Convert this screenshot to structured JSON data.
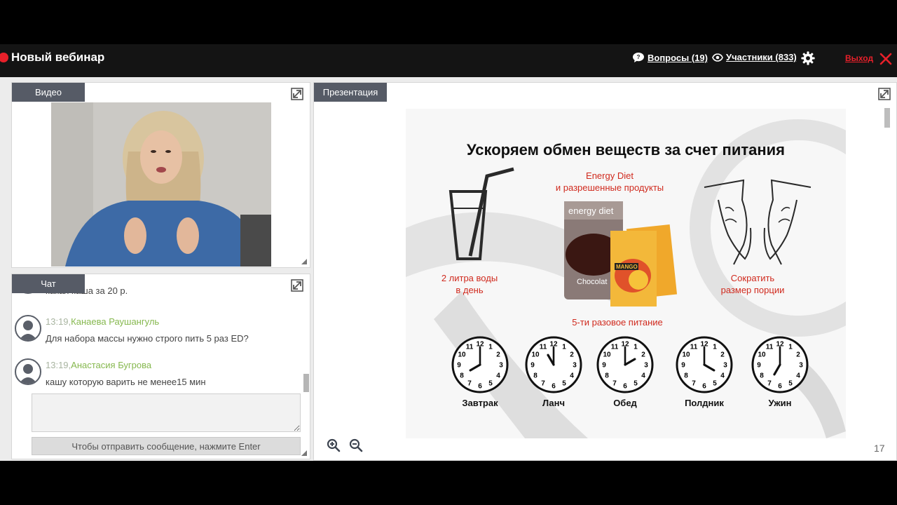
{
  "header": {
    "title": "Новый вебинар",
    "questions_label": "Вопросы (19)",
    "participants_label": "Участники (833)",
    "exit_label": "Выход",
    "accent_color": "#e8202a"
  },
  "video_panel": {
    "tab_label": "Видео"
  },
  "chat_panel": {
    "tab_label": "Чат",
    "partial_message_text": "какая каша за 20 р.",
    "messages": [
      {
        "time": "13:19,",
        "author": "Канаева Раушангуль",
        "text": "Для набора массы нужно строго пить 5 раз ED?"
      },
      {
        "time": "13:19,",
        "author": "Анастасия Бугрова",
        "text": "кашу которую варить не менее15 мин"
      }
    ],
    "send_hint": "Чтобы отправить сообщение, нажмите Enter"
  },
  "presentation_panel": {
    "tab_label": "Презентация",
    "page_number": "17",
    "slide": {
      "title": "Ускоряем обмен веществ за счет питания",
      "water_caption": "2 литра воды\nв день",
      "product_caption": "Energy Diet\nи разрешенные продукты",
      "portion_caption": "Сократить\nразмер порции",
      "meals_caption": "5-ти разовое питание",
      "product_can_text": "energy diet",
      "product_can_flavor": "Chocolat",
      "product_sachet_flavor": "MANGO",
      "clocks": [
        {
          "label": "Завтрак",
          "hour": 8,
          "minute": 0
        },
        {
          "label": "Ланч",
          "hour": 11,
          "minute": 0
        },
        {
          "label": "Обед",
          "hour": 14,
          "minute": 0
        },
        {
          "label": "Полдник",
          "hour": 16,
          "minute": 0
        },
        {
          "label": "Ужин",
          "hour": 19,
          "minute": 0
        }
      ]
    }
  }
}
